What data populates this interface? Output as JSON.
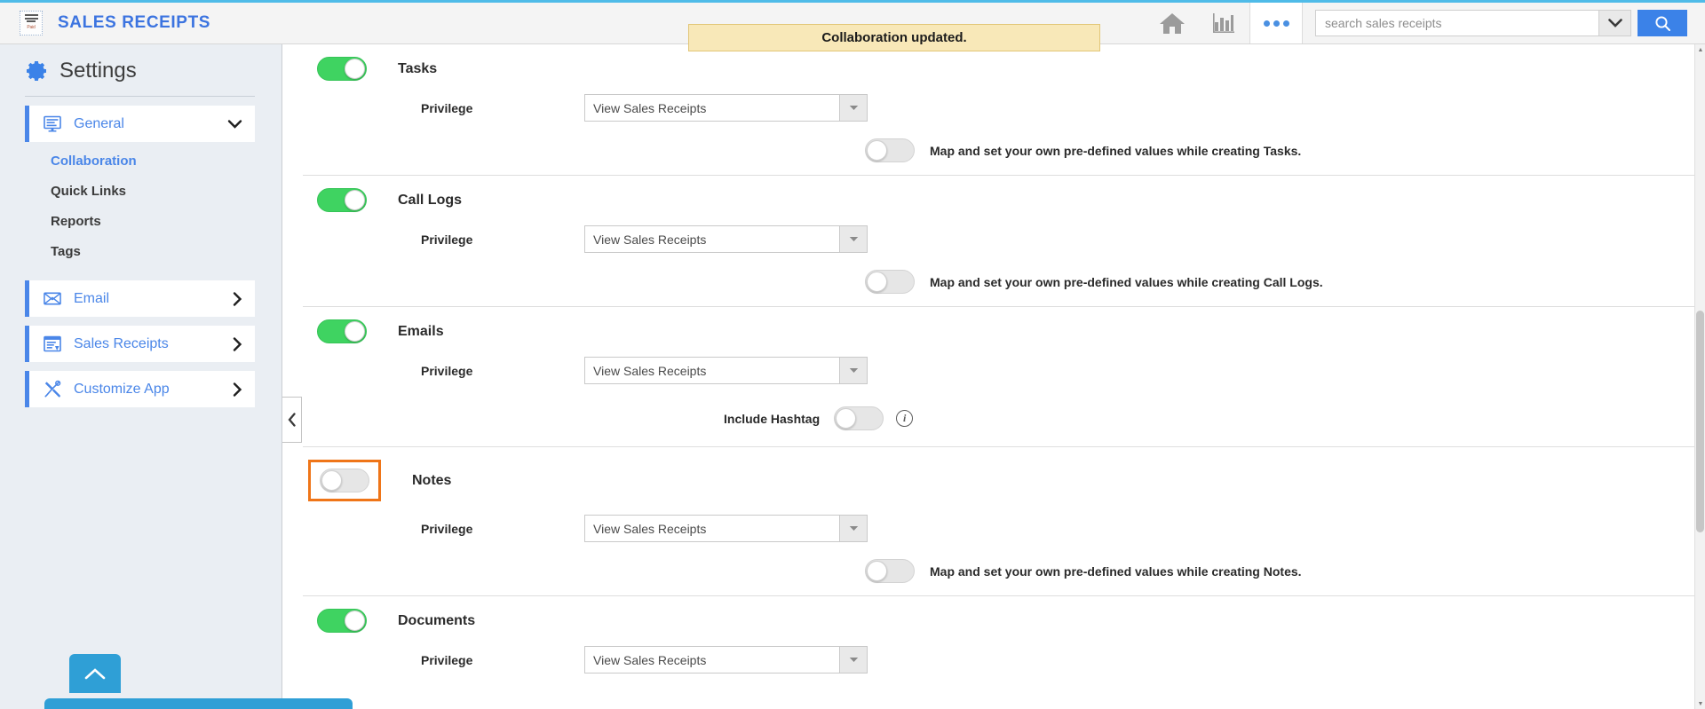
{
  "header": {
    "app_title": "SALES RECEIPTS",
    "logo_paid_text": "Paid",
    "home_icon": "home-icon",
    "reports_icon": "bar-chart-icon",
    "more_icon": "more-dots-icon",
    "search_placeholder": "search sales receipts",
    "search_value": "",
    "search_dropdown_icon": "chevron-down-icon",
    "search_button_icon": "magnifier-icon"
  },
  "notification": {
    "message": "Collaboration updated.",
    "background": "#f8e8b8",
    "border": "#e2c677"
  },
  "sidebar": {
    "title": "Settings",
    "gear_icon": "gear-icon",
    "groups": [
      {
        "label": "General",
        "icon": "monitor-icon",
        "chevron": "chevron-down-icon",
        "expanded": true,
        "items": [
          {
            "label": "Collaboration",
            "active": true
          },
          {
            "label": "Quick Links",
            "active": false
          },
          {
            "label": "Reports",
            "active": false
          },
          {
            "label": "Tags",
            "active": false
          }
        ]
      },
      {
        "label": "Email",
        "icon": "envelope-icon",
        "chevron": "chevron-right-icon",
        "expanded": false,
        "items": []
      },
      {
        "label": "Sales Receipts",
        "icon": "receipt-icon",
        "chevron": "chevron-right-icon",
        "expanded": false,
        "items": []
      },
      {
        "label": "Customize App",
        "icon": "tools-icon",
        "chevron": "chevron-right-icon",
        "expanded": false,
        "items": []
      }
    ]
  },
  "content": {
    "collapse_icon": "chevron-left-icon",
    "privilege_label": "Privilege",
    "scroll_top_icon": "chevron-up-icon",
    "highlight_color": "#ef7518",
    "toggle_on_color": "#3fd361",
    "sections": [
      {
        "title": "Tasks",
        "enabled": true,
        "highlighted": false,
        "privilege_label": "Privilege",
        "privilege_value": "View Sales Receipts",
        "map_enabled": false,
        "map_text": "Map and set your own pre-defined values while creating Tasks.",
        "has_map": true,
        "has_hashtag": false
      },
      {
        "title": "Call Logs",
        "enabled": true,
        "highlighted": false,
        "privilege_label": "Privilege",
        "privilege_value": "View Sales Receipts",
        "map_enabled": false,
        "map_text": "Map and set your own pre-defined values while creating Call Logs.",
        "has_map": true,
        "has_hashtag": false
      },
      {
        "title": "Emails",
        "enabled": true,
        "highlighted": false,
        "privilege_label": "Privilege",
        "privilege_value": "View Sales Receipts",
        "has_map": false,
        "has_hashtag": true,
        "hashtag_label": "Include Hashtag",
        "hashtag_enabled": false,
        "hashtag_info_icon": "info-icon"
      },
      {
        "title": "Notes",
        "enabled": false,
        "highlighted": true,
        "privilege_label": "Privilege",
        "privilege_value": "View Sales Receipts",
        "map_enabled": false,
        "map_text": "Map and set your own pre-defined values while creating Notes.",
        "has_map": true,
        "has_hashtag": false
      },
      {
        "title": "Documents",
        "enabled": true,
        "highlighted": false,
        "privilege_label": "Privilege",
        "privilege_value": "View Sales Receipts",
        "has_map": false,
        "has_hashtag": false
      }
    ]
  }
}
